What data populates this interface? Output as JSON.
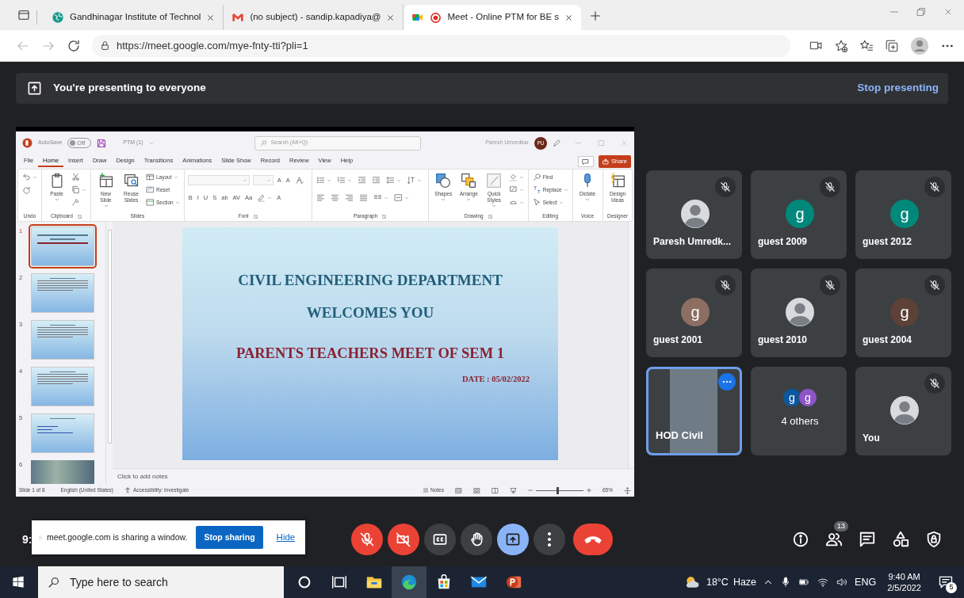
{
  "browser": {
    "tabs": [
      {
        "title": "Gandhinagar Institute of Technol",
        "kind": "globe",
        "recording": false,
        "selected": false
      },
      {
        "title": "(no subject) - sandip.kapadiya@",
        "kind": "mail",
        "recording": false,
        "selected": false
      },
      {
        "title": "Meet - Online PTM for BE s",
        "kind": "meet",
        "recording": true,
        "selected": true
      }
    ],
    "address": "https://meet.google.com/mye-fnty-tti?pli=1"
  },
  "presenting_banner": {
    "text": "You're presenting to everyone",
    "action": "Stop presenting"
  },
  "powerpoint": {
    "autosave": "AutoSave",
    "autosave_on": false,
    "autosave_state": "Off",
    "file_name": "PTM (1)",
    "search_placeholder": "Search (Alt+Q)",
    "user_name": "Paresh Umredkar",
    "user_initials": "PU",
    "menu_tabs": [
      {
        "label": "File",
        "selected": false
      },
      {
        "label": "Home",
        "selected": true
      },
      {
        "label": "Insert",
        "selected": false
      },
      {
        "label": "Draw",
        "selected": false
      },
      {
        "label": "Design",
        "selected": false
      },
      {
        "label": "Transitions",
        "selected": false
      },
      {
        "label": "Animations",
        "selected": false
      },
      {
        "label": "Slide Show",
        "selected": false
      },
      {
        "label": "Record",
        "selected": false
      },
      {
        "label": "Review",
        "selected": false
      },
      {
        "label": "View",
        "selected": false
      },
      {
        "label": "Help",
        "selected": false
      }
    ],
    "share": "Share",
    "ribbon_groups": [
      {
        "label": "Undo",
        "launcher": false,
        "columns": [
          [
            {
              "kind": "undo"
            },
            {
              "kind": "redo"
            }
          ]
        ]
      },
      {
        "label": "Clipboard",
        "launcher": true,
        "columns": [
          [
            {
              "kind": "paste",
              "label": "Paste"
            }
          ],
          [
            {
              "kind": "cut"
            },
            {
              "kind": "copy"
            },
            {
              "kind": "format_painter"
            }
          ]
        ]
      },
      {
        "label": "Slides",
        "launcher": false,
        "columns": [
          [
            {
              "kind": "new_slide",
              "label": "New Slide"
            }
          ],
          [
            {
              "kind": "reuse_slides",
              "label": "Reuse Slides"
            }
          ],
          [
            {
              "kind": "layout",
              "label": "Layout"
            },
            {
              "kind": "reset",
              "label": "Reset"
            },
            {
              "kind": "section",
              "label": "Section"
            }
          ]
        ]
      },
      {
        "label": "Font",
        "launcher": true,
        "controls": [
          {
            "kind": "font_name"
          },
          {
            "kind": "font_size"
          },
          {
            "kind": "letter",
            "text": "A"
          },
          {
            "kind": "letter",
            "text": "A"
          },
          {
            "kind": "clear_format"
          },
          {
            "kind": "letter",
            "text": "B"
          },
          {
            "kind": "letter",
            "text": "I"
          },
          {
            "kind": "letter",
            "text": "U"
          },
          {
            "kind": "letter",
            "text": "S"
          },
          {
            "kind": "letter",
            "text": "ab"
          },
          {
            "kind": "letter",
            "text": "AV"
          },
          {
            "kind": "letter",
            "text": "Aa"
          },
          {
            "kind": "highlight"
          },
          {
            "kind": "letter",
            "text": "A"
          }
        ]
      },
      {
        "label": "Paragraph",
        "launcher": true,
        "controls": [
          {
            "kind": "bullets"
          },
          {
            "kind": "numbering"
          },
          {
            "kind": "outdent"
          },
          {
            "kind": "indent"
          },
          {
            "kind": "line_spacing"
          },
          {
            "kind": "text_direction"
          },
          {
            "kind": "align_left"
          },
          {
            "kind": "align_center"
          },
          {
            "kind": "align_right"
          },
          {
            "kind": "justify"
          },
          {
            "kind": "columns"
          },
          {
            "kind": "align_text"
          }
        ]
      },
      {
        "label": "Drawing",
        "launcher": true,
        "columns": [
          [
            {
              "kind": "shapes",
              "label": "Shapes"
            }
          ],
          [
            {
              "kind": "arrange",
              "label": "Arrange"
            }
          ],
          [
            {
              "kind": "quick_styles",
              "label": "Quick Styles"
            }
          ],
          [
            {
              "kind": "fill"
            },
            {
              "kind": "outline"
            },
            {
              "kind": "effects"
            }
          ]
        ]
      },
      {
        "label": "Editing",
        "launcher": false,
        "columns": [
          [
            {
              "kind": "find",
              "label": "Find"
            },
            {
              "kind": "replace",
              "label": "Replace"
            },
            {
              "kind": "select",
              "label": "Select"
            }
          ]
        ]
      },
      {
        "label": "Voice",
        "launcher": false,
        "columns": [
          [
            {
              "kind": "dictate",
              "label": "Dictate"
            }
          ]
        ]
      },
      {
        "label": "Designer",
        "launcher": false,
        "columns": [
          [
            {
              "kind": "design_ideas",
              "label": "Design Ideas"
            }
          ]
        ]
      }
    ],
    "thumbnails": [
      {
        "number": "1",
        "kind": "title",
        "selected": true
      },
      {
        "number": "2",
        "kind": "text",
        "selected": false
      },
      {
        "number": "3",
        "kind": "text",
        "selected": false
      },
      {
        "number": "4",
        "kind": "text",
        "selected": false
      },
      {
        "number": "5",
        "kind": "links",
        "selected": false
      },
      {
        "number": "6",
        "kind": "photo",
        "selected": false
      }
    ],
    "slide_lines": [
      {
        "text": "CIVIL ENGINEERING DEPARTMENT",
        "kind": "heading"
      },
      {
        "text": "WELCOMES YOU",
        "kind": "heading"
      },
      {
        "text": "PARENTS TEACHERS MEET OF SEM 1",
        "kind": "subheading"
      },
      {
        "text": "DATE : 05/02/2022",
        "kind": "date"
      }
    ],
    "notes_placeholder": "Click to add notes",
    "status": {
      "slide": "Slide 1 of 8",
      "language": "English (United States)",
      "accessibility": "Accessibility: Investigate",
      "notes": "Notes",
      "zoom": "65%",
      "zoom_level": {
        "level": 0.45
      }
    }
  },
  "participants": [
    {
      "name": "Paresh Umredk...",
      "kind": "photo",
      "muted": true,
      "speaking": false
    },
    {
      "name": "guest 2009",
      "kind": "letter",
      "letter": "g",
      "color": "#00897b",
      "muted": true,
      "speaking": false
    },
    {
      "name": "guest 2012",
      "kind": "letter",
      "letter": "g",
      "color": "#00897b",
      "muted": true,
      "speaking": false
    },
    {
      "name": "guest 2001",
      "kind": "letter",
      "letter": "g",
      "color": "#8d6e63",
      "muted": true,
      "speaking": false
    },
    {
      "name": "guest 2010",
      "kind": "photo",
      "muted": true,
      "speaking": false
    },
    {
      "name": "guest 2004",
      "kind": "letter",
      "letter": "g",
      "color": "#5d4037",
      "muted": true,
      "speaking": false
    },
    {
      "name": "HOD Civil",
      "kind": "video",
      "muted": false,
      "speaking": true
    },
    {
      "name": "4 others",
      "kind": "group",
      "members": [
        {
          "letter": "g",
          "color": "#0b57a0"
        },
        {
          "letter": "g",
          "color": "#8e55c8"
        }
      ],
      "muted": false,
      "speaking": false
    },
    {
      "name": "You",
      "kind": "photo",
      "muted": true,
      "speaking": false
    }
  ],
  "bottom_bar": {
    "clock": "9:",
    "share_notice": {
      "text": "meet.google.com is sharing a window.",
      "stop": "Stop sharing",
      "hide": "Hide"
    },
    "controls": [
      {
        "kind": "mic",
        "on": false
      },
      {
        "kind": "camera",
        "on": false
      },
      {
        "kind": "captions",
        "on": false
      },
      {
        "kind": "hand",
        "on": false
      },
      {
        "kind": "present",
        "on": true
      },
      {
        "kind": "more"
      },
      {
        "kind": "end_call"
      }
    ],
    "side_controls": [
      {
        "kind": "info"
      },
      {
        "kind": "people",
        "badge": "13"
      },
      {
        "kind": "chat"
      },
      {
        "kind": "activities"
      },
      {
        "kind": "host_controls"
      }
    ]
  },
  "taskbar": {
    "search_placeholder": "Type here to search",
    "apps": [
      {
        "kind": "cortana",
        "active": false
      },
      {
        "kind": "task_view",
        "active": false
      },
      {
        "kind": "file_explorer",
        "active": false
      },
      {
        "kind": "edge",
        "active": true
      },
      {
        "kind": "store",
        "active": false
      },
      {
        "kind": "mail",
        "active": false
      },
      {
        "kind": "powerpoint",
        "active": false
      }
    ],
    "weather": {
      "temp": "18°C",
      "condition": "Haze"
    },
    "language": "ENG",
    "time": "9:40 AM",
    "date": "2/5/2022",
    "notifications": "5"
  }
}
